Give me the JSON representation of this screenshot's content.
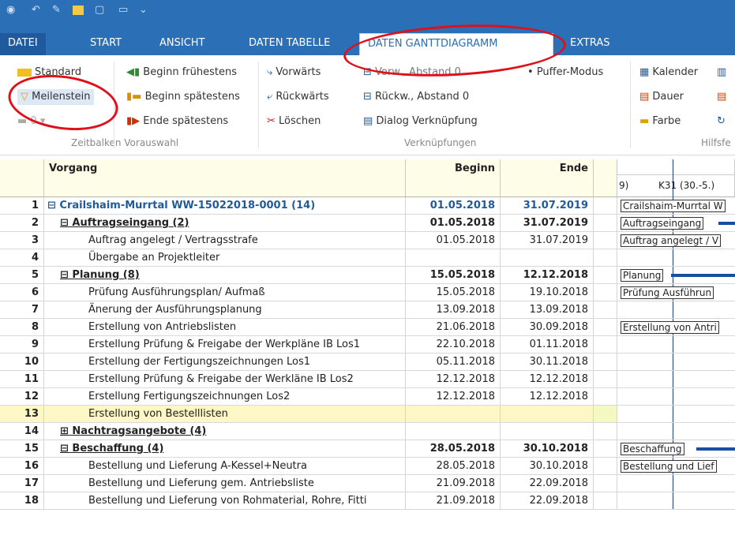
{
  "quick_access": {
    "icons": [
      "app-icon",
      "undo-icon",
      "redo-icon",
      "folder-icon",
      "print-preview-icon",
      "layout-icon"
    ]
  },
  "tabs": [
    "DATEI",
    "START",
    "ANSICHT",
    "DATEN TABELLE",
    "DATEN GANTTDIAGRAMM",
    "EXTRAS"
  ],
  "ribbon": {
    "zeitbalken": {
      "standard": "Standard",
      "meilenstein": "Meilenstein",
      "dropdown_value": "0",
      "label": "Zeitbalken Vorauswahl"
    },
    "beginn": {
      "fruehestens": "Beginn frühestens",
      "spaetestens": "Beginn spätestens",
      "ende": "Ende spätestens"
    },
    "richtung": {
      "vorwaerts": "Vorwärts",
      "rueckwaerts": "Rückwärts",
      "loeschen": "Löschen"
    },
    "verknuepfung": {
      "vorw": "Vorw., Abstand 0",
      "rueckw": "Rückw., Abstand 0",
      "dialog": "Dialog Verknüpfung",
      "puffer": "Puffer-Modus",
      "label": "Verknüpfungen"
    },
    "hilfs": {
      "kalender": "Kalender",
      "dauer": "Dauer",
      "farbe": "Farbe",
      "label": "Hilfsfe"
    }
  },
  "grid": {
    "headers": {
      "vorgang": "Vorgang",
      "beginn": "Beginn",
      "ende": "Ende"
    },
    "gantt_header": {
      "left": "9)",
      "week": "K31 (30.-5.)"
    },
    "rows": [
      {
        "n": "1",
        "name": "⊟ Crailshaim-Murrtal WW-15022018-0001 (14)",
        "b": "01.05.2018",
        "e": "31.07.2019",
        "g": "Crailshaim-Murrtal W",
        "style": "blue",
        "indent": 0
      },
      {
        "n": "2",
        "name": "⊟ Auftragseingang (2)",
        "b": "01.05.2018",
        "e": "31.07.2019",
        "g": "Auftragseingang",
        "style": "bold",
        "indent": 16
      },
      {
        "n": "3",
        "name": "Auftrag angelegt / Vertragsstrafe",
        "b": "01.05.2018",
        "e": "31.07.2019",
        "g": "Auftrag angelegt / V",
        "style": "",
        "indent": 52
      },
      {
        "n": "4",
        "name": "Übergabe an Projektleiter",
        "b": "",
        "e": "",
        "g": "",
        "style": "",
        "indent": 52
      },
      {
        "n": "5",
        "name": "⊟ Planung (8)",
        "b": "15.05.2018",
        "e": "12.12.2018",
        "g": "Planung",
        "style": "bold",
        "indent": 16
      },
      {
        "n": "6",
        "name": "Prüfung Ausführungsplan/ Aufmaß",
        "b": "15.05.2018",
        "e": "19.10.2018",
        "g": "Prüfung Ausführun",
        "style": "",
        "indent": 52
      },
      {
        "n": "7",
        "name": "Änerung der Ausführungsplanung",
        "b": "13.09.2018",
        "e": "13.09.2018",
        "g": "",
        "style": "",
        "indent": 52
      },
      {
        "n": "8",
        "name": "Erstellung von Antriebslisten",
        "b": "21.06.2018",
        "e": "30.09.2018",
        "g": "Erstellung von Antri",
        "style": "",
        "indent": 52
      },
      {
        "n": "9",
        "name": "Erstellung Prüfung & Freigabe der Werkpläne IB Los1",
        "b": "22.10.2018",
        "e": "01.11.2018",
        "g": "",
        "style": "",
        "indent": 52
      },
      {
        "n": "10",
        "name": "Erstellung der Fertigungszeichnungen Los1",
        "b": "05.11.2018",
        "e": "30.11.2018",
        "g": "",
        "style": "",
        "indent": 52
      },
      {
        "n": "11",
        "name": "Erstellung Prüfung & Freigabe der Werkläne IB Los2",
        "b": "12.12.2018",
        "e": "12.12.2018",
        "g": "",
        "style": "",
        "indent": 52
      },
      {
        "n": "12",
        "name": "Erstellung Fertigungszeichnungen Los2",
        "b": "12.12.2018",
        "e": "12.12.2018",
        "g": "",
        "style": "",
        "indent": 52
      },
      {
        "n": "13",
        "name": "Erstellung von Bestelllisten",
        "b": "",
        "e": "",
        "g": "",
        "style": "highlight",
        "indent": 52
      },
      {
        "n": "14",
        "name": "⊞ Nachtragsangebote (4)",
        "b": "",
        "e": "",
        "g": "",
        "style": "bold",
        "indent": 16
      },
      {
        "n": "15",
        "name": "⊟ Beschaffung (4)",
        "b": "28.05.2018",
        "e": "30.10.2018",
        "g": "Beschaffung",
        "style": "bold",
        "indent": 16
      },
      {
        "n": "16",
        "name": "Bestellung und Lieferung A-Kessel+Neutra",
        "b": "28.05.2018",
        "e": "30.10.2018",
        "g": "Bestellung und Lief",
        "style": "",
        "indent": 52
      },
      {
        "n": "17",
        "name": "Bestellung und Lieferung gem. Antriebsliste",
        "b": "21.09.2018",
        "e": "22.09.2018",
        "g": "",
        "style": "",
        "indent": 52
      },
      {
        "n": "18",
        "name": "Bestellung und Lieferung von Rohmaterial, Rohre, Fitti",
        "b": "21.09.2018",
        "e": "22.09.2018",
        "g": "",
        "style": "",
        "indent": 52
      }
    ]
  },
  "colors": {
    "accent": "#2b6fb6",
    "highlight_circle": "#e0101a",
    "summary_text": "#1f5a9e"
  }
}
